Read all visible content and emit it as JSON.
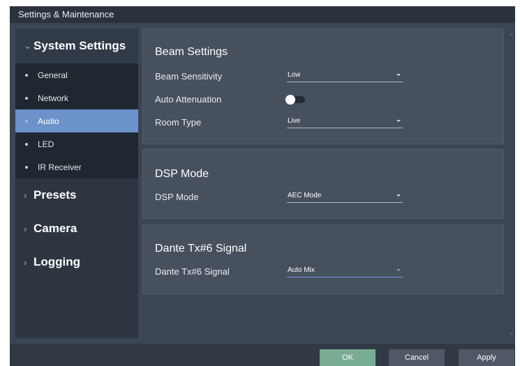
{
  "window": {
    "title": "Settings & Maintenance"
  },
  "sidebar": {
    "system_settings": {
      "label": "System Settings",
      "items": [
        {
          "label": "General"
        },
        {
          "label": "Network"
        },
        {
          "label": "Audio",
          "active": true
        },
        {
          "label": "LED"
        },
        {
          "label": "IR Receiver"
        }
      ]
    },
    "presets": {
      "label": "Presets"
    },
    "camera": {
      "label": "Camera"
    },
    "logging": {
      "label": "Logging"
    }
  },
  "beam_settings": {
    "title": "Beam Settings",
    "beam_sensitivity": {
      "label": "Beam Sensitivity",
      "value": "Low"
    },
    "auto_attenuation": {
      "label": "Auto Attenuation",
      "state": "off"
    },
    "room_type": {
      "label": "Room Type",
      "value": "Live"
    }
  },
  "dsp_mode": {
    "title": "DSP Mode",
    "dsp_mode": {
      "label": "DSP Mode",
      "value": "AEC Mode"
    }
  },
  "dante": {
    "title": "Dante Tx#6 Signal",
    "signal": {
      "label": "Dante Tx#6 Signal",
      "value": "Auto Mix"
    }
  },
  "footer": {
    "ok": "OK",
    "cancel": "Cancel",
    "apply": "Apply"
  },
  "colors": {
    "accent": "#6b93c9",
    "ok_button": "#78ad93"
  }
}
